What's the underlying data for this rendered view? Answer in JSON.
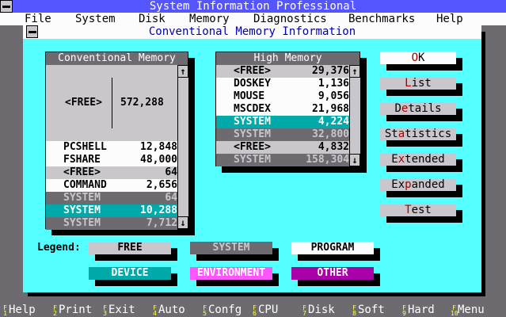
{
  "app_title": "System Information Professional",
  "menu": [
    "File",
    "System",
    "Disk",
    "Memory",
    "Diagnostics",
    "Benchmarks",
    "Help"
  ],
  "dialog_title": "Conventional Memory Information",
  "conventional": {
    "title": "Conventional Memory",
    "large": {
      "name": "<FREE>",
      "value": "572,288"
    },
    "rows": [
      {
        "name": "PCSHELL",
        "value": "12,848",
        "type": "PROGRAM"
      },
      {
        "name": "FSHARE",
        "value": "48,000",
        "type": "PROGRAM"
      },
      {
        "name": "<FREE>",
        "value": "64",
        "type": "FREE"
      },
      {
        "name": "COMMAND",
        "value": "2,656",
        "type": "PROGRAM"
      },
      {
        "name": "SYSTEM",
        "value": "64",
        "type": "SYSTEM"
      },
      {
        "name": "SYSTEM",
        "value": "10,288",
        "type": "DEVICE"
      },
      {
        "name": "SYSTEM",
        "value": "7,712",
        "type": "SYSTEM"
      }
    ]
  },
  "high": {
    "title": "High Memory",
    "rows": [
      {
        "name": "<FREE>",
        "value": "29,376",
        "type": "FREE"
      },
      {
        "name": "DOSKEY",
        "value": "1,136",
        "type": "PROGRAM"
      },
      {
        "name": "MOUSE",
        "value": "9,056",
        "type": "PROGRAM"
      },
      {
        "name": "MSCDEX",
        "value": "21,968",
        "type": "PROGRAM"
      },
      {
        "name": "SYSTEM",
        "value": "4,224",
        "type": "DEVICE"
      },
      {
        "name": "SYSTEM",
        "value": "32,800",
        "type": "SYSTEM"
      },
      {
        "name": "<FREE>",
        "value": "4,832",
        "type": "FREE"
      },
      {
        "name": "SYSTEM",
        "value": "158,304",
        "type": "SYSTEM"
      }
    ]
  },
  "buttons": [
    {
      "pre": "",
      "key": "O",
      "post": "K"
    },
    {
      "pre": "",
      "key": "L",
      "post": "ist"
    },
    {
      "pre": "D",
      "key": "e",
      "post": "tails"
    },
    {
      "pre": "St",
      "key": "a",
      "post": "tistics"
    },
    {
      "pre": "E",
      "key": "x",
      "post": "tended"
    },
    {
      "pre": "Ex",
      "key": "p",
      "post": "anded"
    },
    {
      "pre": "",
      "key": "T",
      "post": "est"
    }
  ],
  "legend": {
    "label": "Legend:",
    "items": [
      {
        "label": "FREE",
        "color": "#c9c7cc"
      },
      {
        "label": "SYSTEM",
        "color": "#6d6b70"
      },
      {
        "label": "PROGRAM",
        "color": "#fcfcfc"
      },
      {
        "label": "DEVICE",
        "color": "#00aaaa"
      },
      {
        "label": "ENVIRONMENT",
        "color": "#ff55ff"
      },
      {
        "label": "OTHER",
        "color": "#aa00aa"
      }
    ]
  },
  "fkeys": [
    {
      "key": "F1",
      "label": "Help"
    },
    {
      "key": "F2",
      "label": "Print"
    },
    {
      "key": "F3",
      "label": "Exit"
    },
    {
      "key": "F4",
      "label": "Auto"
    },
    {
      "key": "F5",
      "label": "Confg"
    },
    {
      "key": "F6",
      "label": "CPU"
    },
    {
      "key": "F7",
      "label": "Disk"
    },
    {
      "key": "F8",
      "label": "Soft"
    },
    {
      "key": "F9",
      "label": "Hard"
    },
    {
      "key": "F10",
      "label": "Menu"
    }
  ]
}
